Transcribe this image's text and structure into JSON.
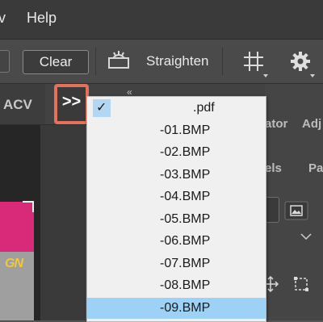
{
  "menubar": {
    "items": [
      {
        "label": "Help"
      }
    ]
  },
  "options_bar": {
    "clear_label": "Clear",
    "straighten_label": "Straighten",
    "icons": [
      "straighten-icon",
      "grid-overlay-icon",
      "gear-icon"
    ]
  },
  "tab_row": {
    "tab_label": "ACV",
    "expand_label": ">>",
    "collapse_label": "«"
  },
  "right_panel": {
    "tabs": [
      "ator",
      "Adj",
      "els",
      "Pa"
    ]
  },
  "dropdown": {
    "items": [
      {
        "label": ".pdf",
        "checked": true
      },
      {
        "label": "-01.BMP"
      },
      {
        "label": "-02.BMP"
      },
      {
        "label": "-03.BMP"
      },
      {
        "label": "-04.BMP"
      },
      {
        "label": "-05.BMP"
      },
      {
        "label": "-06.BMP"
      },
      {
        "label": "-07.BMP"
      },
      {
        "label": "-08.BMP"
      },
      {
        "label": "-09.BMP",
        "selected": true
      }
    ]
  },
  "colors": {
    "highlight_outline": "#e2725b",
    "selection": "#9dd1f5",
    "check_background": "#b3d7f3",
    "canvas_pink": "#d92a7a",
    "canvas_yellow": "#f2c73a"
  }
}
